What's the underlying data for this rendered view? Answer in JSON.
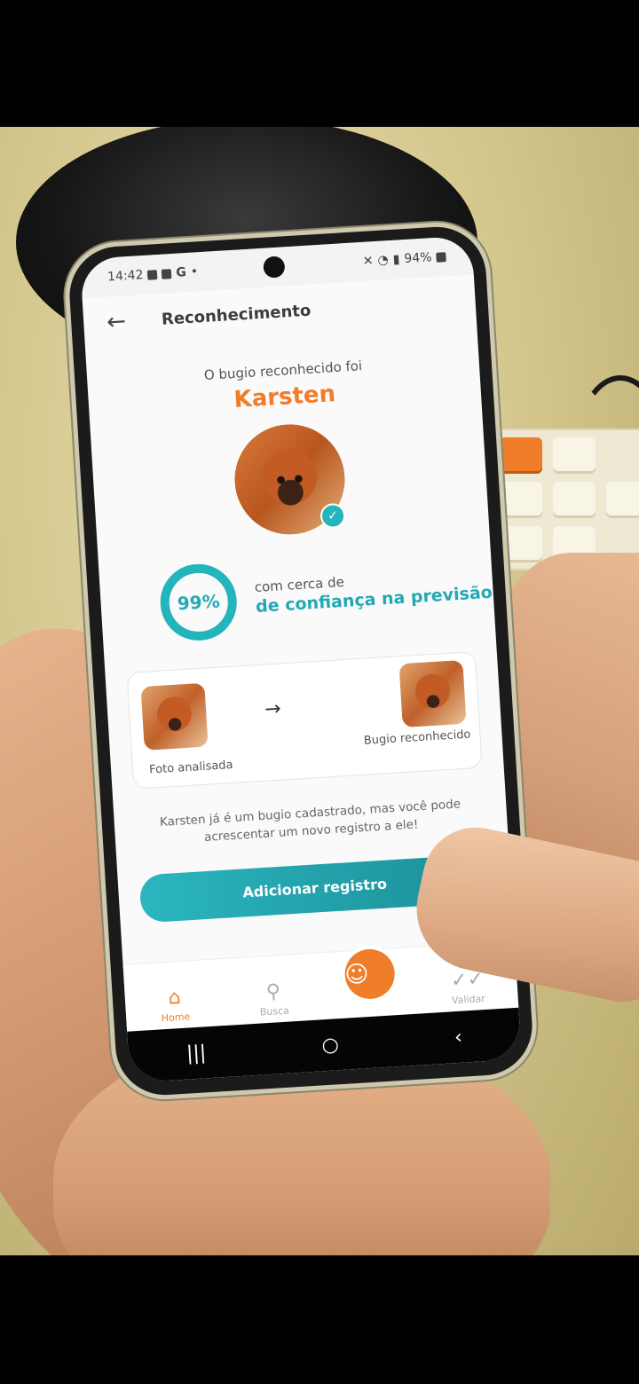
{
  "statusbar": {
    "time": "14:42",
    "left_icons": [
      "calendar-icon",
      "youtube-icon",
      "google-icon",
      "dot-icon"
    ],
    "battery": "94%"
  },
  "appbar": {
    "title": "Reconhecimento"
  },
  "result": {
    "intro": "O bugio reconhecido foi",
    "name": "Karsten",
    "confidence_percent": 99,
    "confidence_label": "99%",
    "confidence_pre": "com cerca de",
    "confidence_main": "de confiança na previsão"
  },
  "compare": {
    "left_label": "Foto analisada",
    "right_label": "Bugio reconhecido"
  },
  "note": "Karsten já é um bugio cadastrado, mas você pode acrescentar um novo registro a ele!",
  "cta_label": "Adicionar registro",
  "nav": {
    "home": "Home",
    "busca": "Busca",
    "validar": "Validar"
  },
  "colors": {
    "accent_orange": "#f07d2a",
    "accent_teal": "#23a9b3"
  }
}
